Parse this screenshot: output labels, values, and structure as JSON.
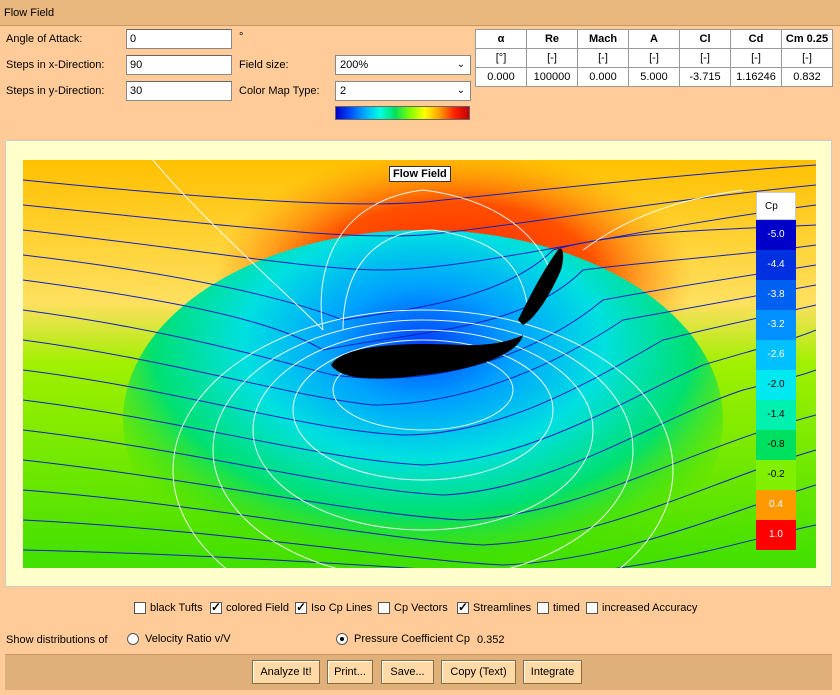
{
  "window": {
    "title": "Flow Field"
  },
  "params": {
    "angle_label": "Angle of Attack:",
    "angle_value": "0",
    "angle_unit": "°",
    "steps_x_label": "Steps in x-Direction:",
    "steps_x_value": "90",
    "steps_y_label": "Steps in y-Direction:",
    "steps_y_value": "30",
    "field_size_label": "Field size:",
    "field_size_value": "200%",
    "colormap_label": "Color Map Type:",
    "colormap_value": "2"
  },
  "results": {
    "headers": [
      "α",
      "Re",
      "Mach",
      "A",
      "Cl",
      "Cd",
      "Cm 0.25"
    ],
    "units": [
      "[°]",
      "[-]",
      "[-]",
      "[-]",
      "[-]",
      "[-]",
      "[-]"
    ],
    "values": [
      "0.000",
      "100000",
      "0.000",
      "5.000",
      "-3.715",
      "1.16246",
      "0.832"
    ]
  },
  "plot": {
    "title": "Flow Field",
    "legend_title": "Cp",
    "legend": [
      {
        "label": "-5.0",
        "color": "#0000C8"
      },
      {
        "label": "-4.4",
        "color": "#0030E0"
      },
      {
        "label": "-3.8",
        "color": "#0060F0"
      },
      {
        "label": "-3.2",
        "color": "#0090FF"
      },
      {
        "label": "-2.6",
        "color": "#00C0FF"
      },
      {
        "label": "-2.0",
        "color": "#00E8F0"
      },
      {
        "label": "-1.4",
        "color": "#00F0B0"
      },
      {
        "label": "-0.8",
        "color": "#00E060"
      },
      {
        "label": "-0.2",
        "color": "#80F000"
      },
      {
        "label": "0.4",
        "color": "#FF9900"
      },
      {
        "label": "1.0",
        "color": "#FF0000"
      }
    ]
  },
  "options": {
    "black_tufts": {
      "label": "black Tufts",
      "checked": false
    },
    "colored_field": {
      "label": "colored Field",
      "checked": true
    },
    "iso_cp": {
      "label": "Iso Cp Lines",
      "checked": true
    },
    "cp_vectors": {
      "label": "Cp Vectors",
      "checked": false
    },
    "streamlines": {
      "label": "Streamlines",
      "checked": true
    },
    "timed": {
      "label": "timed",
      "checked": false
    },
    "accuracy": {
      "label": "increased Accuracy",
      "checked": false
    }
  },
  "distribution": {
    "label": "Show distributions of",
    "velocity_label": "Velocity Ratio v/V",
    "cp_label": "Pressure Coefficient Cp",
    "cp_value": "0.352"
  },
  "buttons": {
    "analyze": "Analyze It!",
    "print": "Print...",
    "save": "Save...",
    "copy": "Copy (Text)",
    "integrate": "Integrate"
  }
}
